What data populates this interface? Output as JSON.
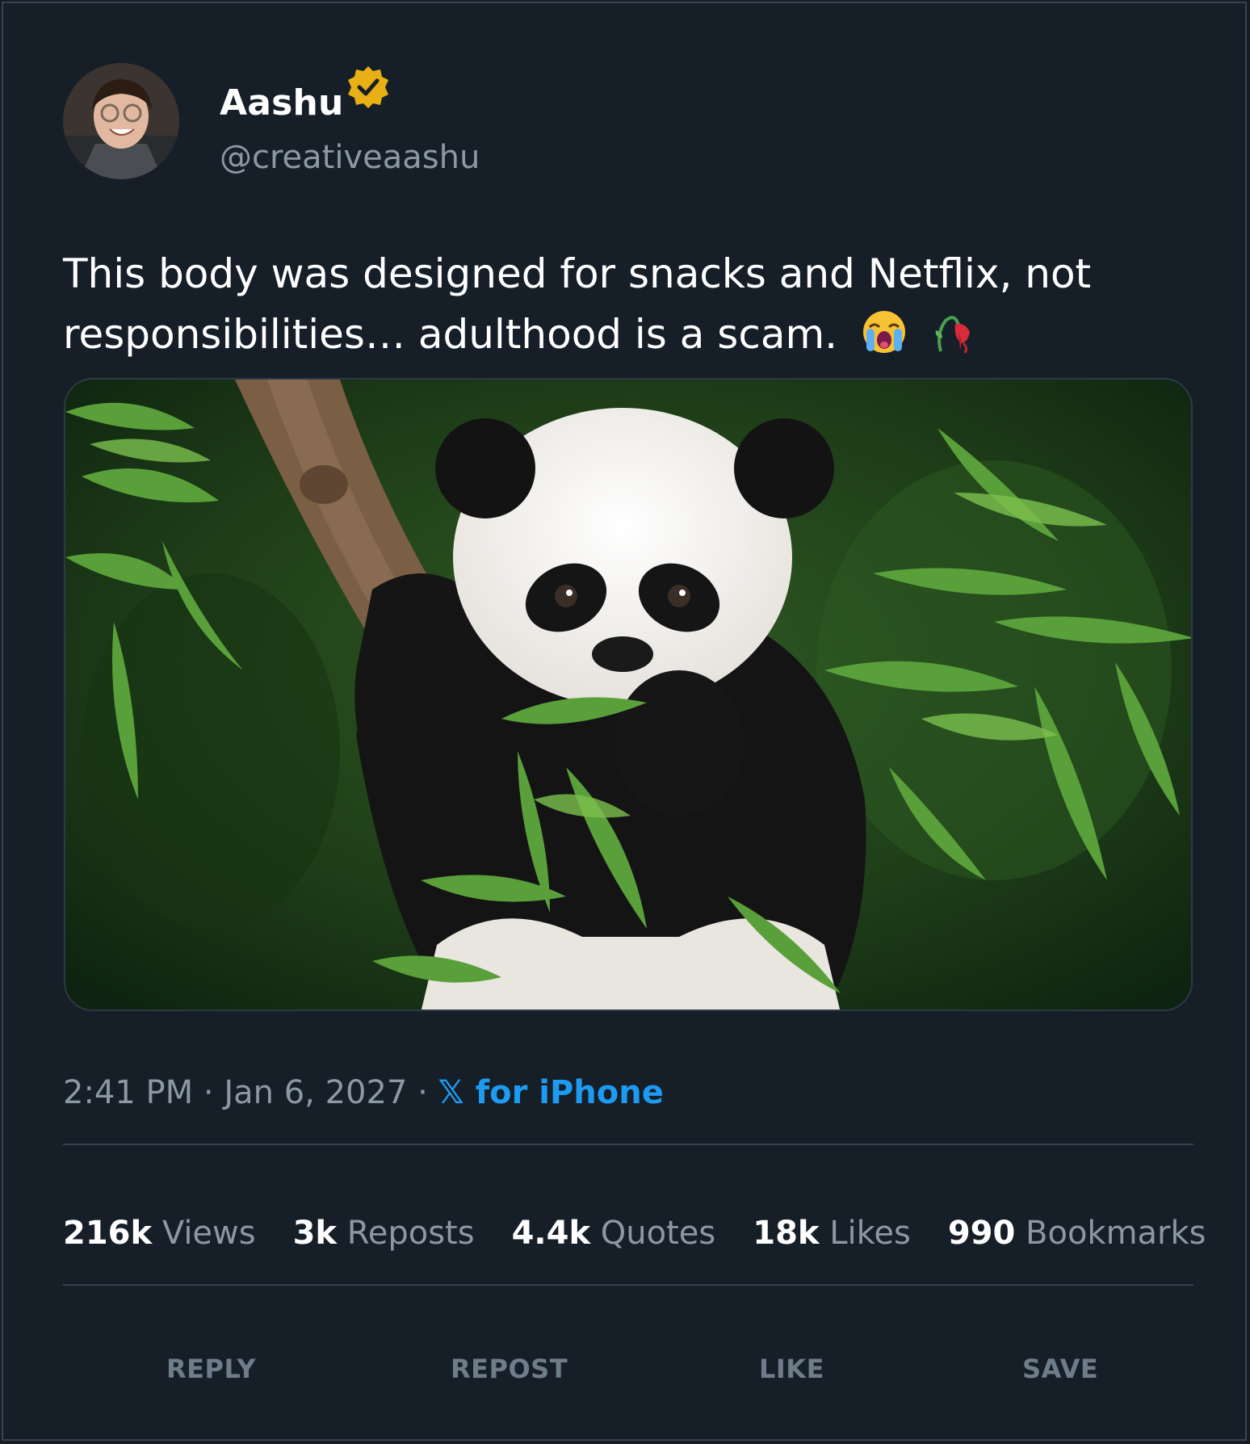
{
  "author": {
    "name": "Aashu",
    "handle": "@creativeaashu",
    "verified": true,
    "badge_color": "#e8b014"
  },
  "tweet": {
    "text": "This body was designed for snacks and Netflix, not responsibilities… adulthood is a scam.",
    "emojis": [
      "loudly-crying-face",
      "wilted-flower"
    ]
  },
  "meta": {
    "time": "2:41 PM",
    "separator": "·",
    "date": "Jan 6, 2027",
    "source_logo": "𝕏",
    "source_text": "for iPhone",
    "source_color": "#1d9bf0"
  },
  "stats": [
    {
      "value": "216k",
      "label": "Views"
    },
    {
      "value": "3k",
      "label": "Reposts"
    },
    {
      "value": "4.4k",
      "label": "Quotes"
    },
    {
      "value": "18k",
      "label": "Likes"
    },
    {
      "value": "990",
      "label": "Bookmarks"
    }
  ],
  "actions": {
    "reply": "REPLY",
    "repost": "REPOST",
    "like": "LIKE",
    "save": "SAVE"
  }
}
